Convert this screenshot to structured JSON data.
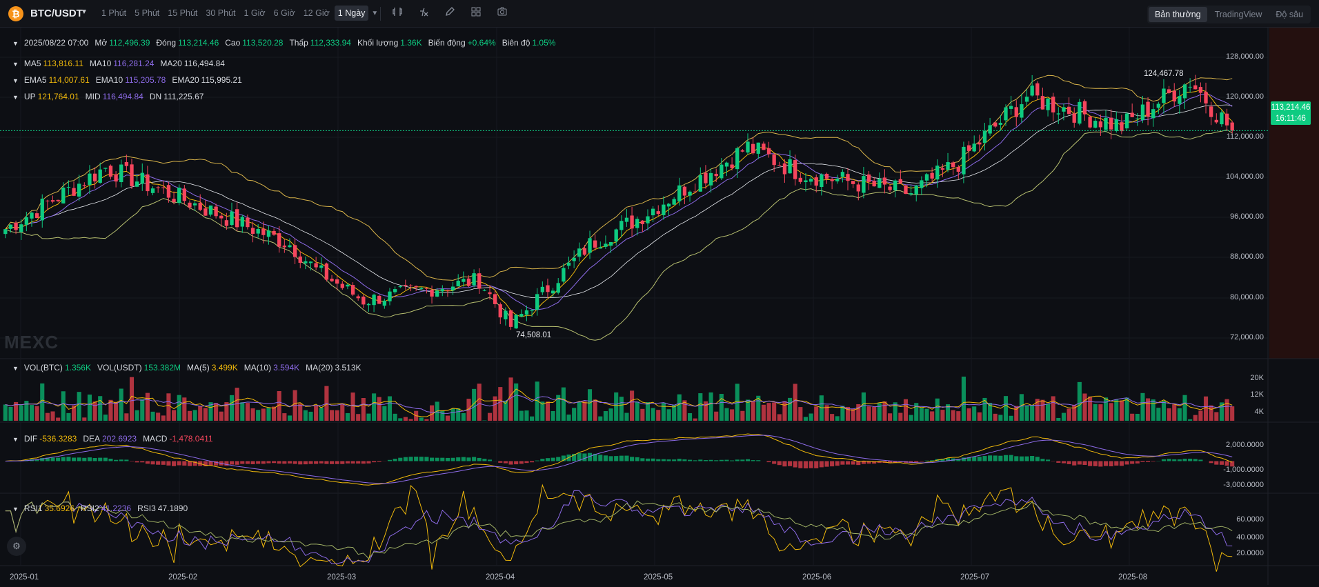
{
  "header": {
    "logo_glyph": "₿",
    "symbol": "BTC/USDT",
    "intervals": [
      "1 Phút",
      "5 Phút",
      "15 Phút",
      "30 Phút",
      "1 Giờ",
      "6 Giờ",
      "12 Giờ",
      "1 Ngày"
    ],
    "active_interval": "1 Ngày",
    "tools": [
      "candle-type-icon",
      "indicator-fx-icon",
      "draw-pen-icon",
      "layout-grid-icon",
      "camera-icon"
    ],
    "views": [
      "Bản thường",
      "TradingView",
      "Độ sâu"
    ],
    "active_view": "Bản thường"
  },
  "legend": {
    "ohlc": [
      {
        "k": "2025/08/22 07:00",
        "v": ""
      },
      {
        "k": "Mở",
        "v": "112,496.39"
      },
      {
        "k": "Đóng",
        "v": "113,214.46"
      },
      {
        "k": "Cao",
        "v": "113,520.28"
      },
      {
        "k": "Thấp",
        "v": "112,333.94"
      },
      {
        "k": "Khối lượng",
        "v": "1.36K"
      },
      {
        "k": "Biến động",
        "v": "+0.64%"
      },
      {
        "k": "Biên độ",
        "v": "1.05%"
      }
    ],
    "ma": [
      {
        "k": "MA5",
        "v": "113,816.11"
      },
      {
        "k": "MA10",
        "v": "116,281.24"
      },
      {
        "k": "MA20",
        "v": "116,494.84"
      }
    ],
    "ema": [
      {
        "k": "EMA5",
        "v": "114,007.61"
      },
      {
        "k": "EMA10",
        "v": "115,205.78"
      },
      {
        "k": "EMA20",
        "v": "115,995.21"
      }
    ],
    "boll": [
      {
        "k": "UP",
        "v": "121,764.01"
      },
      {
        "k": "MID",
        "v": "116,494.84"
      },
      {
        "k": "DN",
        "v": "111,225.67"
      }
    ],
    "vol": [
      {
        "k": "VOL(BTC)",
        "v": "1.356K"
      },
      {
        "k": "VOL(USDT)",
        "v": "153.382M"
      },
      {
        "k": "MA(5)",
        "v": "3.499K"
      },
      {
        "k": "MA(10)",
        "v": "3.594K"
      },
      {
        "k": "MA(20)",
        "v": "3.513K"
      }
    ],
    "macd": [
      {
        "k": "DIF",
        "v": "-536.3283"
      },
      {
        "k": "DEA",
        "v": "202.6923"
      },
      {
        "k": "MACD",
        "v": "-1,478.0411"
      }
    ],
    "rsi": [
      {
        "k": "RSI1",
        "v": "35.6926"
      },
      {
        "k": "RSI2",
        "v": "41.2236"
      },
      {
        "k": "RSI3",
        "v": "47.1890"
      }
    ]
  },
  "price_axis": [
    "128,000.00",
    "120,000.00",
    "112,000.00",
    "104,000.00",
    "96,000.00",
    "88,000.00",
    "80,000.00",
    "72,000.00"
  ],
  "vol_axis": [
    "20K",
    "12K",
    "4K"
  ],
  "macd_axis": [
    "2,000.0000",
    "-1,000.0000",
    "-3,000.0000"
  ],
  "rsi_axis": [
    "60.0000",
    "40.0000",
    "20.0000"
  ],
  "dates": [
    "2025-01",
    "2025-02",
    "2025-03",
    "2025-04",
    "2025-05",
    "2025-06",
    "2025-07",
    "2025-08"
  ],
  "current_price": {
    "price": "113,214.46",
    "countdown": "16:11:46"
  },
  "annotations": {
    "high": "124,467.78",
    "low": "74,508.01"
  },
  "watermark": "MEXC",
  "colors": {
    "up": "#0ecb81",
    "down": "#f6465d",
    "ma5": "#f0b90b",
    "ma10": "#8d6be8",
    "ma20": "#e6e9ee",
    "boll": "#d9b44a"
  },
  "chart_data": {
    "type": "candlestick",
    "title": "BTC/USDT",
    "interval": "1 Ngày",
    "x_range": [
      "2025-01-01",
      "2025-08-22"
    ],
    "ylim": [
      70000,
      132000
    ],
    "anchors": [
      {
        "date": "2025-01-01",
        "close": 94000
      },
      {
        "date": "2025-01-20",
        "close": 106000
      },
      {
        "date": "2025-02-01",
        "close": 101000
      },
      {
        "date": "2025-02-24",
        "close": 91000
      },
      {
        "date": "2025-03-01",
        "close": 86000
      },
      {
        "date": "2025-03-10",
        "close": 80000
      },
      {
        "date": "2025-04-01",
        "close": 84000
      },
      {
        "date": "2025-04-07",
        "close": 75000
      },
      {
        "date": "2025-04-22",
        "close": 91000
      },
      {
        "date": "2025-05-01",
        "close": 96000
      },
      {
        "date": "2025-05-22",
        "close": 110000
      },
      {
        "date": "2025-06-01",
        "close": 105000
      },
      {
        "date": "2025-06-22",
        "close": 101000
      },
      {
        "date": "2025-07-01",
        "close": 107000
      },
      {
        "date": "2025-07-14",
        "close": 120000
      },
      {
        "date": "2025-08-01",
        "close": 114000
      },
      {
        "date": "2025-08-14",
        "close": 123000
      },
      {
        "date": "2025-08-22",
        "close": 113214
      }
    ],
    "high_marker": 124467.78,
    "low_marker": 74508.01,
    "indicators": [
      "MA5",
      "MA10",
      "MA20",
      "EMA5",
      "EMA10",
      "EMA20",
      "BOLL",
      "VOL",
      "MACD",
      "RSI"
    ]
  }
}
